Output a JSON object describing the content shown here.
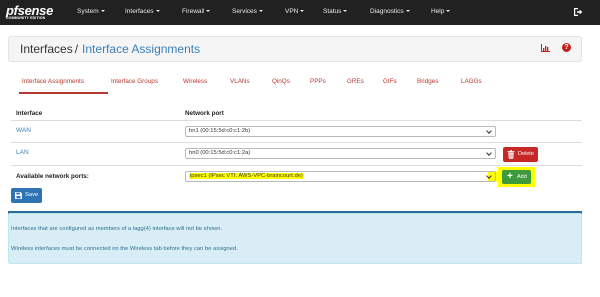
{
  "brand": {
    "logo_text": "pfsense",
    "edition": "COMMUNITY EDITION"
  },
  "navbar": {
    "items": [
      {
        "label": "System"
      },
      {
        "label": "Interfaces"
      },
      {
        "label": "Firewall"
      },
      {
        "label": "Services"
      },
      {
        "label": "VPN"
      },
      {
        "label": "Status"
      },
      {
        "label": "Diagnostics"
      },
      {
        "label": "Help"
      }
    ],
    "logout_icon": "sign-out-icon"
  },
  "breadcrumb": {
    "parent": "Interfaces",
    "separator": "/",
    "current": "Interface Assignments"
  },
  "tabs": [
    {
      "label": "Interface Assignments",
      "active": true
    },
    {
      "label": "Interface Groups"
    },
    {
      "label": "Wireless"
    },
    {
      "label": "VLANs"
    },
    {
      "label": "QinQs"
    },
    {
      "label": "PPPs"
    },
    {
      "label": "GREs"
    },
    {
      "label": "GIFs"
    },
    {
      "label": "Bridges"
    },
    {
      "label": "LAGGs"
    }
  ],
  "table": {
    "headers": {
      "interface": "Interface",
      "network_port": "Network port"
    },
    "rows": [
      {
        "interface": "WAN",
        "port": "hn1 (00:15:5d:c0:c1:2b)"
      },
      {
        "interface": "LAN",
        "port": "hn0 (00:15:5d:c0:c1:2a)",
        "action": "Delete"
      }
    ],
    "available": {
      "label": "Available network ports:",
      "port": "ipsec1 (IPsec VTI: AWS-VPC-braincourt.de)",
      "action": "Add"
    }
  },
  "buttons": {
    "save": "Save"
  },
  "info": {
    "line1": "Interfaces that are configured as members of a lagg(4) interface will not be shown.",
    "line2": "Wireless interfaces must be connected on the Wireless tab before they can be assigned."
  },
  "colors": {
    "accent": "#b73a31",
    "link": "#3b80b8",
    "highlight": "#ffff00",
    "add": "#3c9a3c",
    "delete": "#c62828",
    "save": "#2e74b5",
    "info_bg": "#d9edf7"
  }
}
